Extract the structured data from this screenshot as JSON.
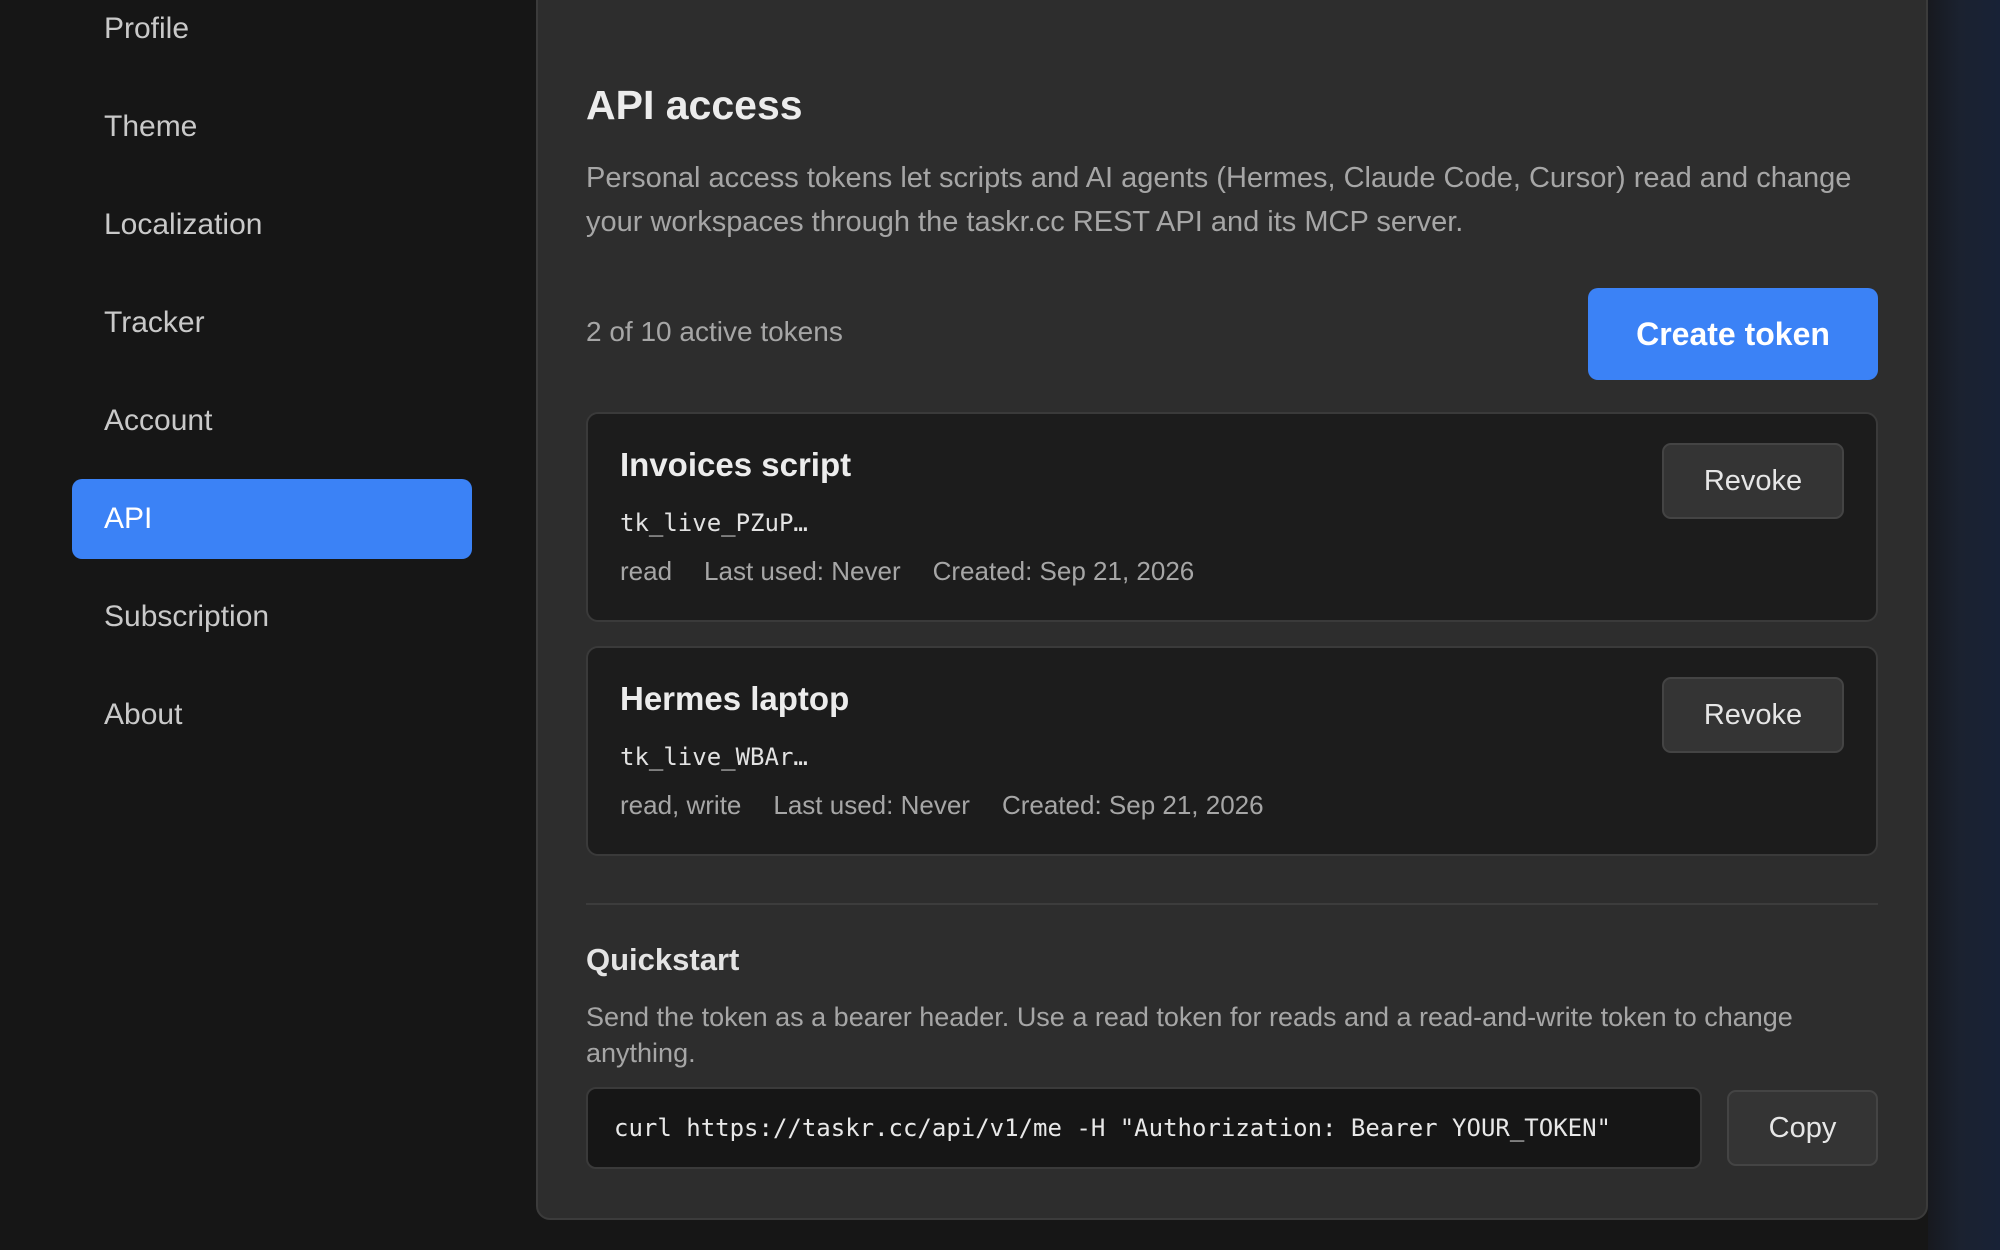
{
  "sidebar": {
    "items": [
      {
        "label": "Profile",
        "active": false
      },
      {
        "label": "Theme",
        "active": false
      },
      {
        "label": "Localization",
        "active": false
      },
      {
        "label": "Tracker",
        "active": false
      },
      {
        "label": "Account",
        "active": false
      },
      {
        "label": "API",
        "active": true
      },
      {
        "label": "Subscription",
        "active": false
      },
      {
        "label": "About",
        "active": false
      }
    ]
  },
  "main": {
    "title": "API access",
    "description": "Personal access tokens let scripts and AI agents (Hermes, Claude Code, Cursor) read and change your workspaces through the taskr.cc REST API and its MCP server.",
    "token_count": "2 of 10 active tokens",
    "create_label": "Create token",
    "tokens": [
      {
        "name": "Invoices script",
        "key": "tk_live_PZuP…",
        "scope": "read",
        "last_used": "Last used: Never",
        "created": "Created: Sep 21, 2026",
        "revoke_label": "Revoke"
      },
      {
        "name": "Hermes laptop",
        "key": "tk_live_WBAr…",
        "scope": "read, write",
        "last_used": "Last used: Never",
        "created": "Created: Sep 21, 2026",
        "revoke_label": "Revoke"
      }
    ],
    "quickstart": {
      "title": "Quickstart",
      "description": "Send the token as a bearer header. Use a read token for reads and a read-and-write token to change anything.",
      "command": "curl https://taskr.cc/api/v1/me -H \"Authorization: Bearer YOUR_TOKEN\"",
      "copy_label": "Copy"
    }
  },
  "colors": {
    "accent": "#3b82f6",
    "background": "#161616",
    "panel": "#2d2d2d",
    "card": "#1c1c1c"
  }
}
